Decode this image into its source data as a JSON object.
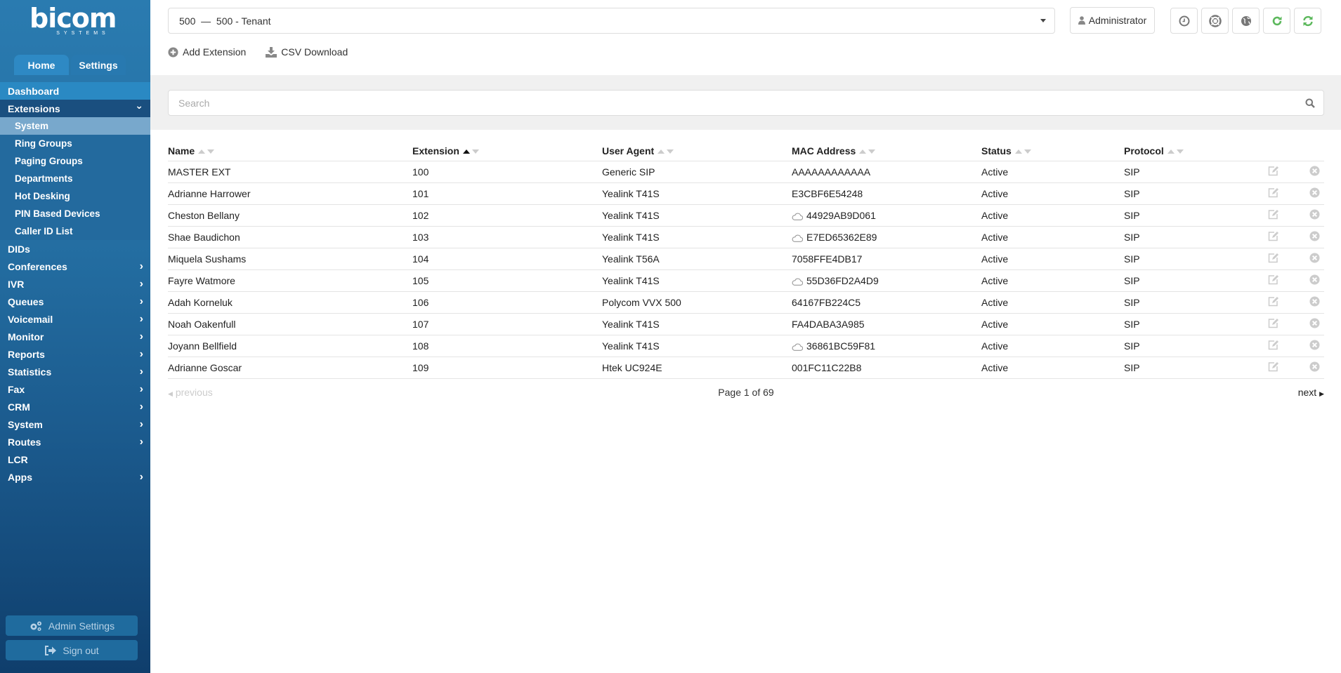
{
  "brand": {
    "name": "bicom",
    "sub": "SYSTEMS"
  },
  "sidebar": {
    "tabs": [
      {
        "label": "Home",
        "active": true
      },
      {
        "label": "Settings",
        "active": false
      }
    ],
    "items": [
      {
        "label": "Dashboard",
        "has_children": false
      },
      {
        "label": "Extensions",
        "has_children": true,
        "expanded": true,
        "children": [
          {
            "label": "System",
            "active": true
          },
          {
            "label": "Ring Groups"
          },
          {
            "label": "Paging Groups"
          },
          {
            "label": "Departments"
          },
          {
            "label": "Hot Desking"
          },
          {
            "label": "PIN Based Devices"
          },
          {
            "label": "Caller ID List"
          }
        ]
      },
      {
        "label": "DIDs",
        "has_children": false
      },
      {
        "label": "Conferences",
        "has_children": true
      },
      {
        "label": "IVR",
        "has_children": true
      },
      {
        "label": "Queues",
        "has_children": true
      },
      {
        "label": "Voicemail",
        "has_children": true
      },
      {
        "label": "Monitor",
        "has_children": true
      },
      {
        "label": "Reports",
        "has_children": true
      },
      {
        "label": "Statistics",
        "has_children": true
      },
      {
        "label": "Fax",
        "has_children": true
      },
      {
        "label": "CRM",
        "has_children": true
      },
      {
        "label": "System",
        "has_children": true
      },
      {
        "label": "Routes",
        "has_children": true
      },
      {
        "label": "LCR",
        "has_children": false
      },
      {
        "label": "Apps",
        "has_children": true
      }
    ],
    "admin_settings_label": "Admin Settings",
    "sign_out_label": "Sign out"
  },
  "header": {
    "tenant_select": "500  —  500 - Tenant",
    "user_label": "Administrator",
    "icons": [
      "clock-icon",
      "lifebuoy-icon",
      "globe-icon",
      "reload-icon",
      "sync-icon"
    ],
    "actions": {
      "add_extension": "Add Extension",
      "csv_download": "CSV Download"
    }
  },
  "search": {
    "placeholder": "Search",
    "value": ""
  },
  "table": {
    "columns": [
      {
        "label": "Name",
        "sort": "none"
      },
      {
        "label": "Extension",
        "sort": "asc"
      },
      {
        "label": "User Agent",
        "sort": "none"
      },
      {
        "label": "MAC Address",
        "sort": "none"
      },
      {
        "label": "Status",
        "sort": "none"
      },
      {
        "label": "Protocol",
        "sort": "none"
      }
    ],
    "rows": [
      {
        "name": "MASTER EXT",
        "extension": "100",
        "user_agent": "Generic SIP",
        "mac": "AAAAAAAAAAAA",
        "cloud": false,
        "status": "Active",
        "protocol": "SIP"
      },
      {
        "name": "Adrianne Harrower",
        "extension": "101",
        "user_agent": "Yealink T41S",
        "mac": "E3CBF6E54248",
        "cloud": false,
        "status": "Active",
        "protocol": "SIP"
      },
      {
        "name": "Cheston Bellany",
        "extension": "102",
        "user_agent": "Yealink T41S",
        "mac": "44929AB9D061",
        "cloud": true,
        "status": "Active",
        "protocol": "SIP"
      },
      {
        "name": "Shae Baudichon",
        "extension": "103",
        "user_agent": "Yealink T41S",
        "mac": "E7ED65362E89",
        "cloud": true,
        "status": "Active",
        "protocol": "SIP"
      },
      {
        "name": "Miquela Sushams",
        "extension": "104",
        "user_agent": "Yealink T56A",
        "mac": "7058FFE4DB17",
        "cloud": false,
        "status": "Active",
        "protocol": "SIP"
      },
      {
        "name": "Fayre Watmore",
        "extension": "105",
        "user_agent": "Yealink T41S",
        "mac": "55D36FD2A4D9",
        "cloud": true,
        "status": "Active",
        "protocol": "SIP"
      },
      {
        "name": "Adah Korneluk",
        "extension": "106",
        "user_agent": "Polycom VVX 500",
        "mac": "64167FB224C5",
        "cloud": false,
        "status": "Active",
        "protocol": "SIP"
      },
      {
        "name": "Noah Oakenfull",
        "extension": "107",
        "user_agent": "Yealink T41S",
        "mac": "FA4DABA3A985",
        "cloud": false,
        "status": "Active",
        "protocol": "SIP"
      },
      {
        "name": "Joyann Bellfield",
        "extension": "108",
        "user_agent": "Yealink T41S",
        "mac": "36861BC59F81",
        "cloud": true,
        "status": "Active",
        "protocol": "SIP"
      },
      {
        "name": "Adrianne Goscar",
        "extension": "109",
        "user_agent": "Htek UC924E",
        "mac": "001FC11C22B8",
        "cloud": false,
        "status": "Active",
        "protocol": "SIP"
      }
    ]
  },
  "pagination": {
    "previous_label": "previous",
    "page_info": "Page 1 of 69",
    "next_label": "next"
  },
  "colors": {
    "refresh_green": "#5cb85c",
    "sidebar_top": "#2a7bb0",
    "sidebar_bottom": "#0f3e6c",
    "active_subitem": "#78a8cc"
  }
}
